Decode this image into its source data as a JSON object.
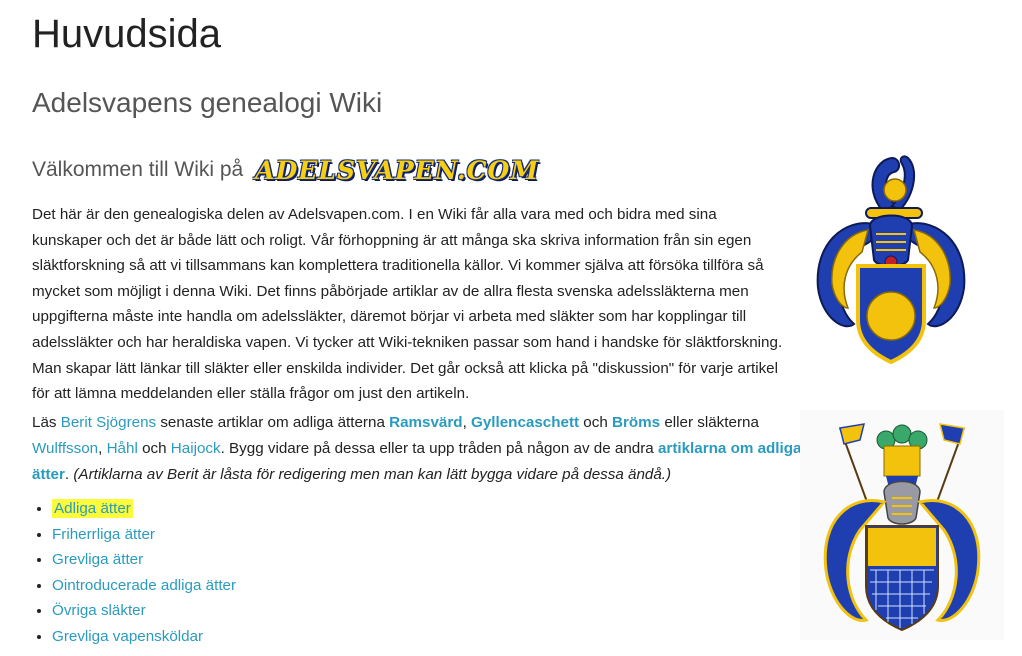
{
  "page": {
    "title": "Huvudsida",
    "subtitle": "Adelsvapens genealogi Wiki",
    "welcome": "Välkommen till Wiki på",
    "logo_text": "ADELSVAPEN.COM"
  },
  "intro": "Det här är den genealogiska delen av Adelsvapen.com. I en Wiki får alla vara med och bidra med sina kunskaper och det är både lätt och roligt. Vår förhoppning är att många ska skriva information från sin egen släktforskning så att vi tillsammans kan komplettera traditionella källor. Vi kommer själva att försöka tillföra så mycket som möjligt i denna Wiki. Det finns påbörjade artiklar av de allra flesta svenska adelssläkterna men uppgifterna måste inte handla om adelssläkter, däremot börjar vi arbeta med släkter som har kopplingar till adelssläkter och har heraldiska vapen. Vi tycker att Wiki-tekniken passar som hand i handske för släktforskning. Man skapar lätt länkar till släkter eller enskilda individer. Det går också att klicka på \"diskussion\" för varje artikel för att lämna meddelanden eller ställa frågor om just den artikeln.",
  "recent": {
    "t_las": "Läs ",
    "author": "Berit Sjögrens",
    "t_senaste": " senaste artiklar om adliga ätterna ",
    "l1": "Ramsvärd",
    "t_comma": ", ",
    "l2": "Gyllencaschett",
    "t_och1": " och ",
    "l3": "Bröms",
    "t_eller": " eller släkterna ",
    "l4": "Wulffsson",
    "t_comma2": ", ",
    "l5": "Håhl",
    "t_och2": " och ",
    "l6": "Haijock",
    "t_bygg": ". Bygg vidare på dessa eller ta upp tråden på någon av de andra ",
    "l7": "artiklarna om adliga ätter",
    "t_dot": ". ",
    "note": "(Artiklarna av Berit är låsta för redigering men man kan lätt bygga vidare på dessa ändå.)"
  },
  "links": [
    "Adliga ätter",
    "Friherrliga ätter",
    "Grevliga ätter",
    "Ointroducerade adliga ätter",
    "Övriga släkter",
    "Grevliga vapensköldar"
  ],
  "colors": {
    "link": "#2a9bbf",
    "highlight": "#fbfb3b",
    "heraldry_gold": "#f2c20d",
    "heraldry_blue": "#1f3fb0"
  }
}
